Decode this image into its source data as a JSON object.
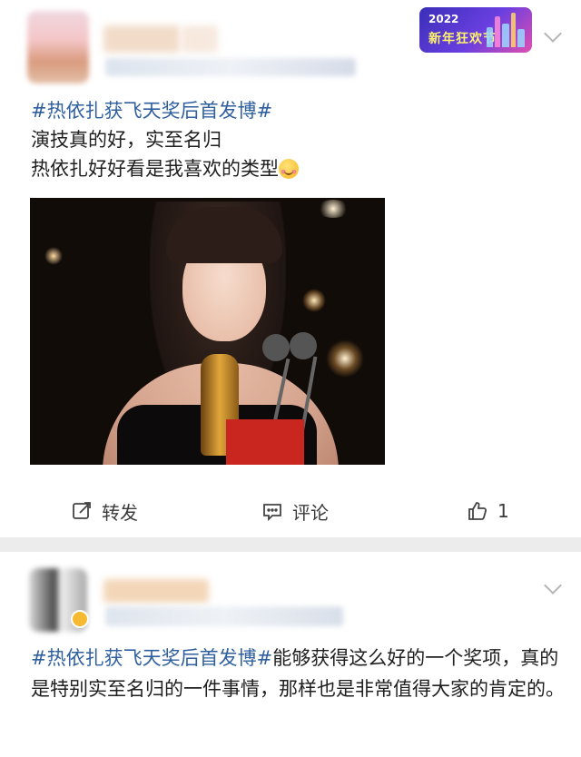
{
  "post1": {
    "hashtag": "#热依扎获飞天奖后首发博#",
    "line1": "演技真的好，实至名归",
    "line2": "热依扎好好看是我喜欢的类型",
    "emoji": "smiling-face-emoji",
    "event_badge": {
      "year": "2022",
      "name": "新年狂欢节"
    },
    "actions": {
      "repost_label": "转发",
      "comment_label": "评论",
      "like_count": "1"
    }
  },
  "post2": {
    "hashtag": "#热依扎获飞天奖后首发博#",
    "text": "能够获得这么好的一个奖项，真的是特别实至名归的一件事情，那样也是非常值得大家的肯定的。"
  },
  "icons": {
    "repost": "repost-icon",
    "comment": "comment-icon",
    "like": "thumbs-up-icon",
    "more": "chevron-down-icon"
  },
  "colors": {
    "hashtag": "#2f5f9e",
    "text": "#1f1f1f",
    "background": "#ececec"
  }
}
